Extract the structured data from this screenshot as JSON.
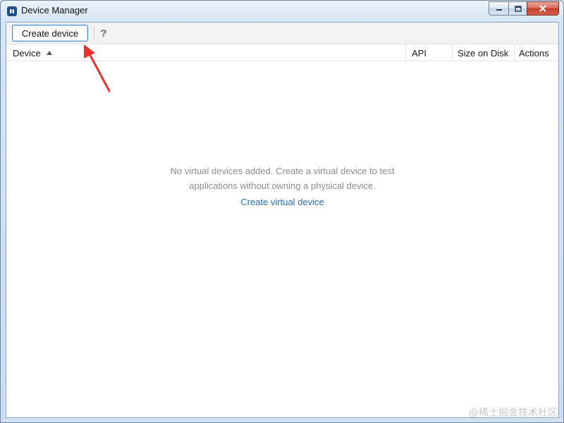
{
  "window": {
    "title": "Device Manager",
    "controls": {
      "minimize_icon": "minimize-icon",
      "maximize_icon": "maximize-icon",
      "close_icon": "close-icon"
    }
  },
  "toolbar": {
    "create_label": "Create device",
    "help_label": "?"
  },
  "table": {
    "columns": [
      "Device",
      "API",
      "Size on Disk",
      "Actions"
    ],
    "sort": {
      "column": "Device",
      "direction": "ascending"
    }
  },
  "empty_state": {
    "line1": "No virtual devices added. Create a virtual device to test",
    "line2": "applications without owning a physical device.",
    "link": "Create virtual device"
  },
  "watermark": "@稀土掘金技术社区",
  "colors": {
    "accent": "#2a6fb0",
    "annotation": "#e8322d",
    "close_button": "#c2402b"
  }
}
